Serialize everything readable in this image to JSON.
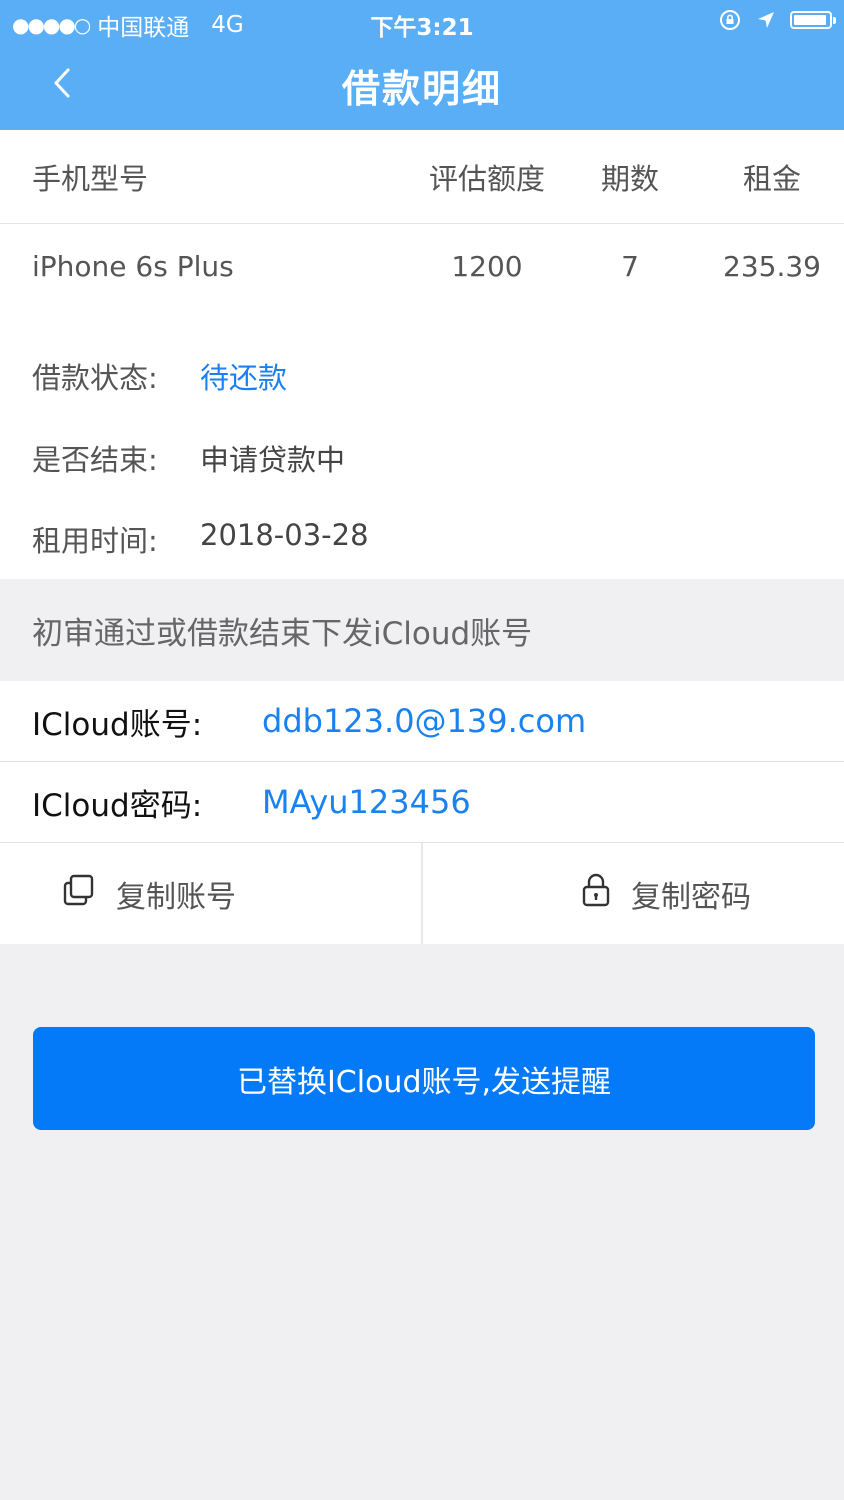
{
  "status_bar": {
    "signal": "●●●●○",
    "carrier": "中国联通",
    "network": "4G",
    "time": "下午3:21",
    "battery_level": 0.95
  },
  "header": {
    "title": "借款明细",
    "background_color": "#5aaef5"
  },
  "table": {
    "columns": [
      "手机型号",
      "评估额度",
      "期数",
      "租金"
    ],
    "row": {
      "model": "iPhone 6s Plus",
      "amount": "1200",
      "periods": "7",
      "rent": "235.39"
    }
  },
  "info": {
    "status_label": "借款状态:",
    "status_value": "待还款",
    "finished_label": "是否结束:",
    "finished_value": "申请贷款中",
    "rent_time_label": "租用时间:",
    "rent_time_value": "2018-03-28"
  },
  "notice": "初审通过或借款结束下发iCloud账号",
  "credentials": {
    "account_label": "ICloud账号:",
    "account_value": "ddb123.0@139.com",
    "password_label": "ICloud密码:",
    "password_value": "MAyu123456"
  },
  "actions": {
    "copy_account": "复制账号",
    "copy_password": "复制密码",
    "main_button": "已替换ICloud账号,发送提醒",
    "main_button_color": "#057af8",
    "link_color": "#1a82f0"
  }
}
